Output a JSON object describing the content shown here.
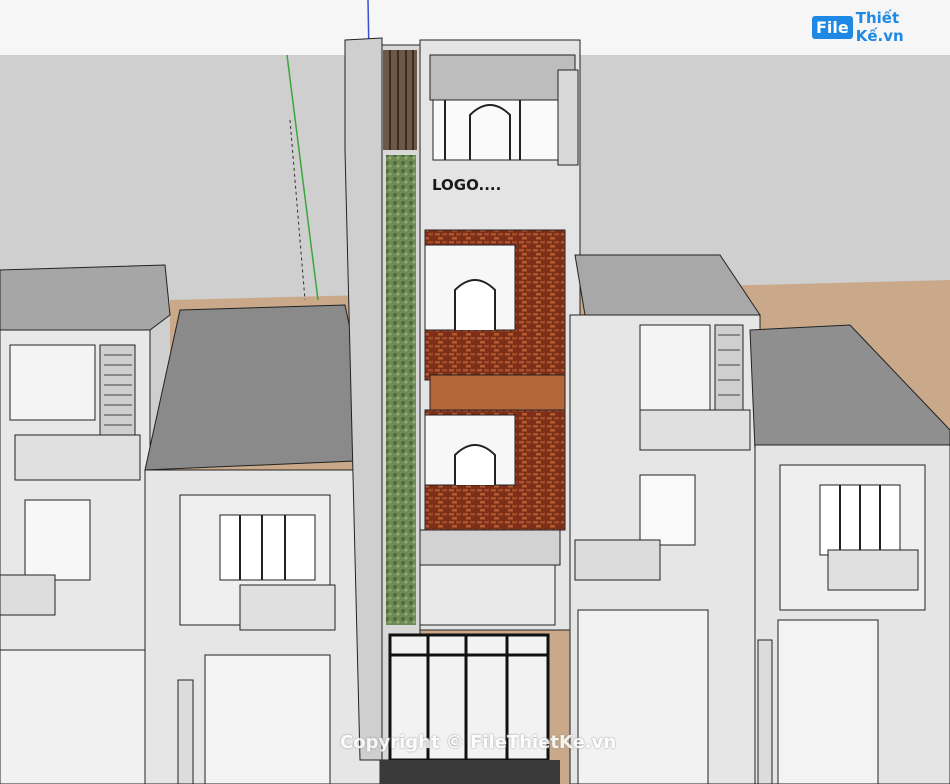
{
  "image": {
    "sign_text": "LOGO....",
    "watermark_brand_badge": "File",
    "watermark_brand_text": "Thiết Kế.vn",
    "copyright_text": "Copyright © FileThietKe.vn"
  },
  "colors": {
    "sky": "#f4f4f4",
    "ground": "#c9a98a",
    "wall": "#e6e6e6",
    "roof_dark": "#808080",
    "brick": "#8a3a20",
    "brand_blue": "#1e88e5"
  }
}
